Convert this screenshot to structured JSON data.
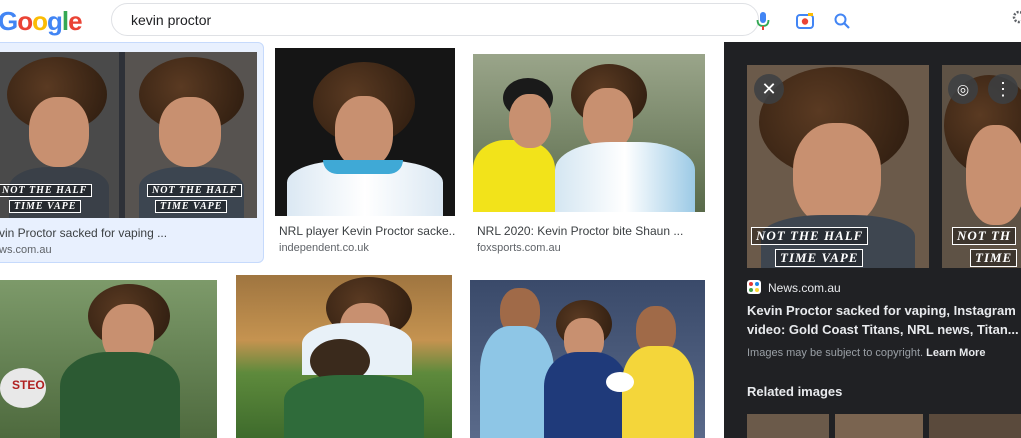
{
  "header": {
    "logo_letters": [
      {
        "ch": "G",
        "color": "#4285F4"
      },
      {
        "ch": "o",
        "color": "#EA4335"
      },
      {
        "ch": "o",
        "color": "#FBBC05"
      },
      {
        "ch": "g",
        "color": "#4285F4"
      },
      {
        "ch": "l",
        "color": "#34A853"
      },
      {
        "ch": "e",
        "color": "#EA4335"
      }
    ],
    "search_query": "kevin proctor"
  },
  "results": [
    {
      "caption": "vin Proctor sacked for vaping ...",
      "source": "ws.com.au",
      "overlay_line1": "NOT THE HALF",
      "overlay_line2": "TIME VAPE"
    },
    {
      "caption": "NRL player Kevin Proctor sacke...",
      "source": "independent.co.uk"
    },
    {
      "caption": "NRL 2020: Kevin Proctor bite Shaun ...",
      "source": "foxsports.com.au"
    },
    {
      "caption": "",
      "source": ""
    },
    {
      "caption": "",
      "source": ""
    },
    {
      "caption": "",
      "source": ""
    }
  ],
  "panel": {
    "source": "News.com.au",
    "title": "Kevin Proctor sacked for vaping, Instagram video: Gold Coast Titans, NRL news, Titan...",
    "copyright": "Images may be subject to copyright.",
    "learn_more": "Learn More",
    "related": "Related images",
    "overlay_line1": "NOT THE HALF",
    "overlay_line2": "TIME VAPE",
    "overlay2_line1": "NOT TH",
    "overlay2_line2": "TIME"
  },
  "colors": {
    "accent_blue": "#1a73e8",
    "panel_bg": "#202124",
    "selected_bg": "#e8f0fe"
  },
  "icons": [
    "mic-icon",
    "camera-lens-icon",
    "search-icon",
    "settings-icon",
    "close-icon",
    "lens-icon",
    "more-vert-icon"
  ]
}
